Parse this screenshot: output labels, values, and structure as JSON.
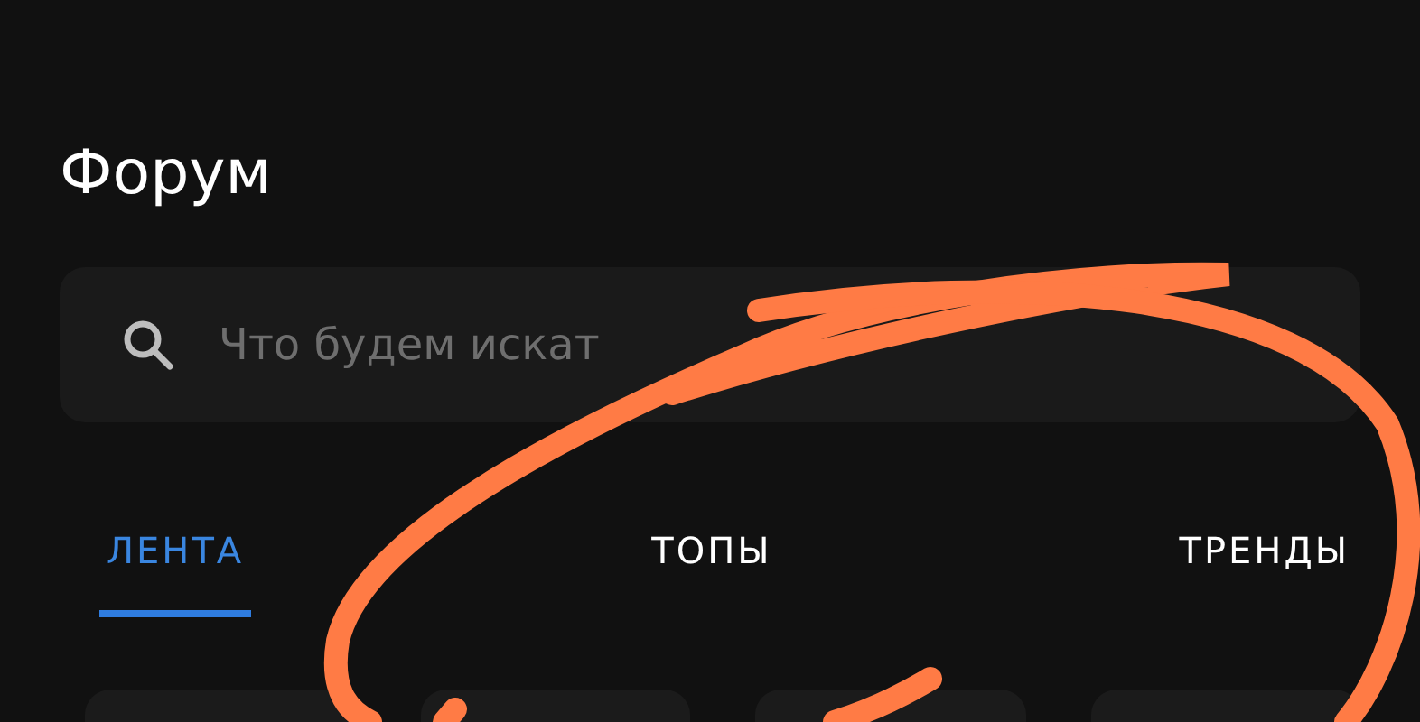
{
  "title": "Форум",
  "search": {
    "placeholder": "Что будем искат"
  },
  "tabs": [
    {
      "label": "ЛЕНТА",
      "selected": true
    },
    {
      "label": "ТОПЫ",
      "selected": false
    },
    {
      "label": "ТРЕНДЫ",
      "selected": false
    }
  ]
}
